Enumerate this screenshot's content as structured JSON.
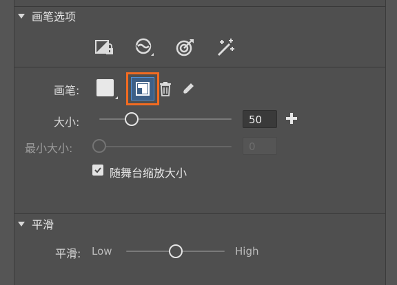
{
  "brush_options": {
    "title": "画笔选项",
    "brush_label": "画笔:",
    "size_label": "大小:",
    "size_value": "50",
    "min_size_label": "最小大小:",
    "min_size_value": "0",
    "scale_with_stage_label": "随舞台缩放大小",
    "scale_with_stage_checked": true,
    "size_slider_level": 50
  },
  "smoothing": {
    "title": "平滑",
    "label": "平滑:",
    "low_label": "Low",
    "high_label": "High",
    "slider_level": 0.5
  },
  "icons": {
    "toolbar": [
      "lock-fill-icon",
      "brush-mode-icon",
      "target-icon",
      "magic-wand-icon"
    ],
    "brush": [
      "brush-shape-icon",
      "trash-icon",
      "pencil-icon"
    ]
  },
  "colors": {
    "selection_highlight": "#f26b21",
    "selected_fill": "#3d5f86",
    "panel_bg": "#4f4f4f"
  }
}
